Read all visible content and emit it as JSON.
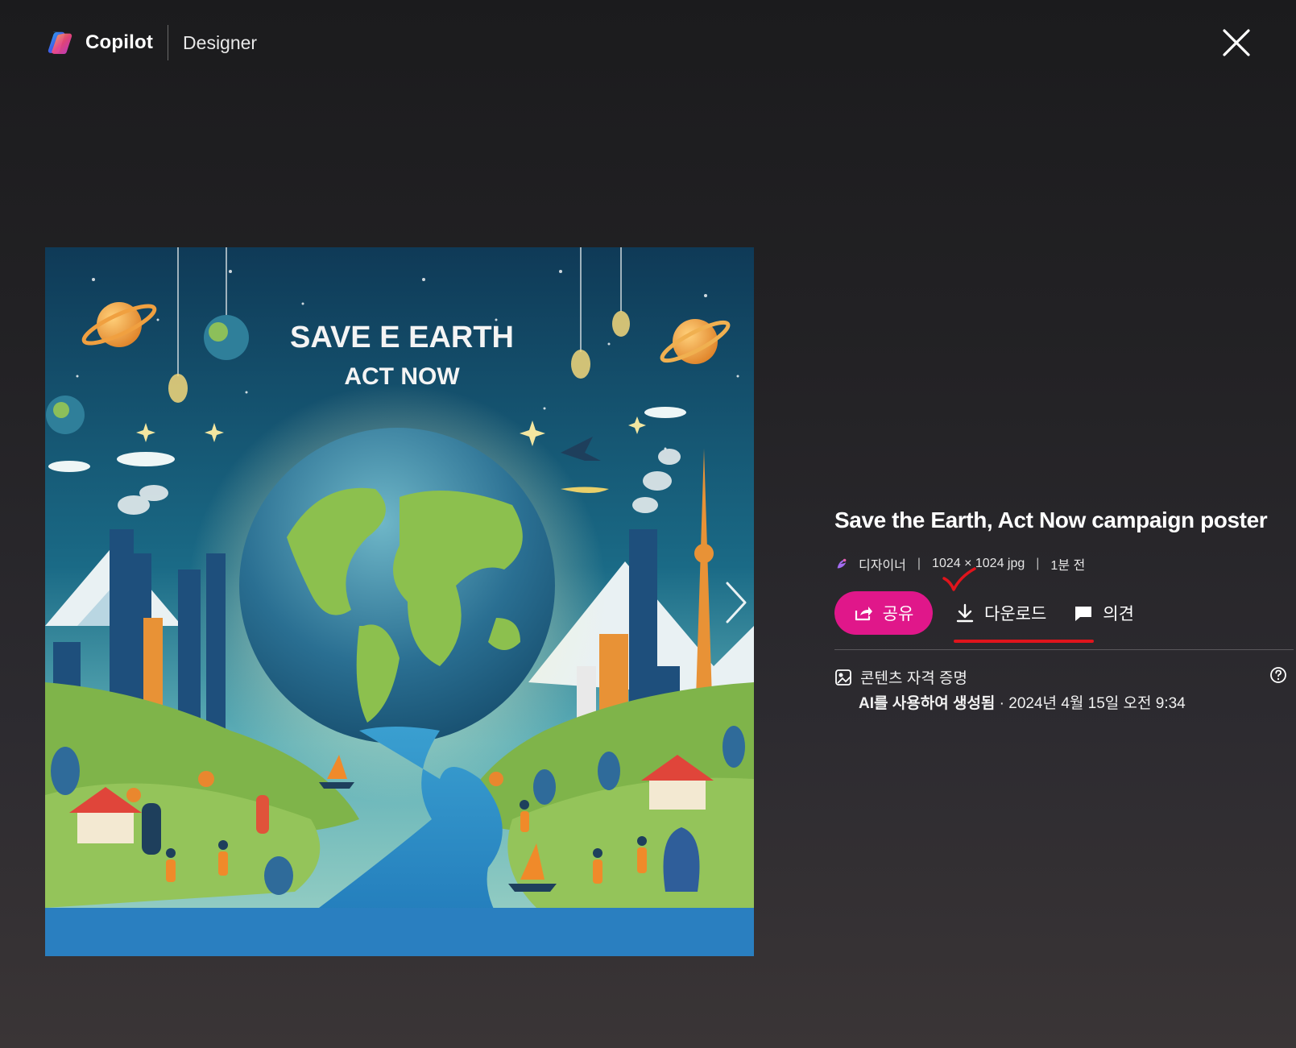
{
  "header": {
    "brand": "Copilot",
    "product": "Designer",
    "close_icon": "close-icon"
  },
  "poster": {
    "headline": "SAVE E EARTH",
    "subhead": "ACT NOW"
  },
  "details": {
    "title": "Save the Earth, Act Now campaign poster",
    "source": "디자이너",
    "dimensions": "1024 × 1024 jpg",
    "age": "1분 전",
    "sep": "|",
    "share_label": "공유",
    "download_label": "다운로드",
    "feedback_label": "의견",
    "credentials_title": "콘텐츠 자격 증명",
    "generated_label": "AI를 사용하여 생성됨",
    "generated_date": " · 2024년 4월 15일 오전 9:34"
  },
  "colors": {
    "share_button": "#e0178a",
    "annotation": "#e0141c"
  }
}
